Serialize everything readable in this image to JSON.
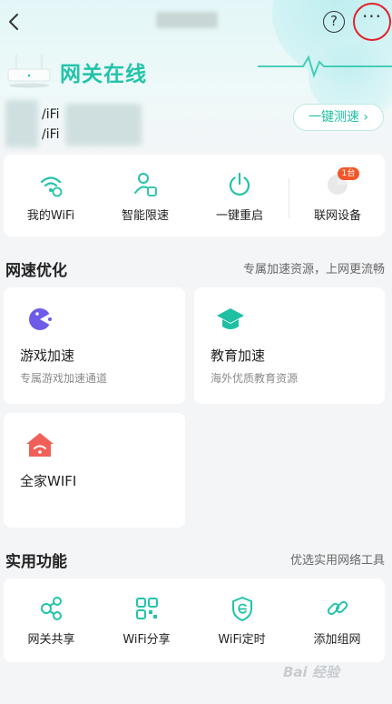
{
  "header": {
    "back_icon": "chevron-left-icon",
    "help_label": "?",
    "more_label": "···"
  },
  "gateway": {
    "status": "网关在线",
    "wifi_lines": [
      "/iFi",
      "/iFi"
    ],
    "speed_test": "一键测速 ›"
  },
  "quick_actions": [
    {
      "label": "我的WiFi",
      "icon": "wifi-settings-icon"
    },
    {
      "label": "智能限速",
      "icon": "user-limit-icon"
    },
    {
      "label": "一键重启",
      "icon": "power-icon"
    },
    {
      "label": "联网设备",
      "icon": "devices-icon",
      "badge": "1台"
    }
  ],
  "speed_section": {
    "title": "网速优化",
    "subtitle": "专属加速资源，上网更流畅",
    "tiles": [
      {
        "title": "游戏加速",
        "subtitle": "专属游戏加速通道",
        "icon": "game-icon"
      },
      {
        "title": "教育加速",
        "subtitle": "海外优质教育资源",
        "icon": "graduation-cap-icon"
      },
      {
        "title": "全家WIFI",
        "subtitle": "",
        "icon": "home-wifi-icon"
      }
    ]
  },
  "tools_section": {
    "title": "实用功能",
    "subtitle": "优选实用网络工具",
    "items": [
      {
        "label": "网关共享",
        "icon": "share-icon"
      },
      {
        "label": "WiFi分享",
        "icon": "qr-code-icon"
      },
      {
        "label": "WiFi定时",
        "icon": "timer-shield-icon"
      },
      {
        "label": "添加组网",
        "icon": "link-icon"
      }
    ]
  },
  "colors": {
    "accent": "#22c3a9",
    "game": "#6c5ce7",
    "home": "#f0605a",
    "badge": "#f0582b",
    "highlight_ring": "#e0222a"
  },
  "watermark": "Bai 经验"
}
